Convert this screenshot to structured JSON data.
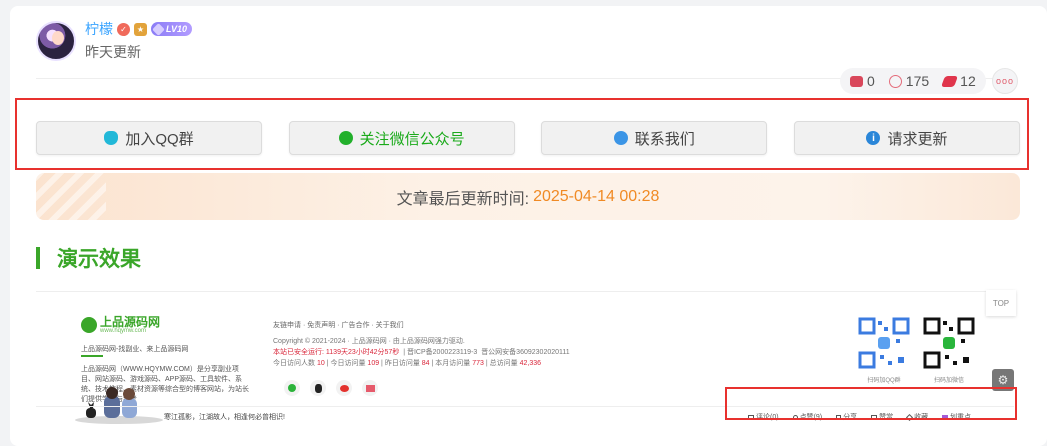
{
  "author": {
    "name": "柠檬",
    "level": "LV10",
    "updated": "昨天更新"
  },
  "stats": {
    "comments": "0",
    "likes": "175",
    "shares": "12"
  },
  "buttons": {
    "qq": "加入QQ群",
    "wechat": "关注微信公众号",
    "contact": "联系我们",
    "request": "请求更新"
  },
  "notice": {
    "label": "文章最后更新时间:",
    "time": "2025-04-14 00:28"
  },
  "section": {
    "title": "演示效果"
  },
  "demo": {
    "logo_name": "上品源码网",
    "logo_url": "www.hqymw.com",
    "tagline": "上品源码网-找副业、来上品源码网",
    "desc": "上品源码网（WWW.HQYMW.COM）是分享副业项目、网站源码、游戏源码、APP源码、工具软件、系统、技术教程、素材资源等综合型的博客网站，为站长们提供学习与参考",
    "links": "友链申请 · 免责声明 · 广告合作 · 关于我们",
    "copyright": "Copyright © 2021-2024 · 上品源码网 · 由上品源码网强力驱动.",
    "run_label": "本站已安全运行:",
    "run_time": "1139天23小时42分57秒",
    "icp": "晋ICP备2000223119-3",
    "police": "晋公网安备36092302020111",
    "today_label": "今日访问人数",
    "today": "10",
    "today_visits_label": "今日访问量",
    "today_visits": "109",
    "yesterday_label": "昨日访问量",
    "yesterday": "84",
    "month_label": "本月访问量",
    "month": "773",
    "total_label": "总访问量",
    "total": "42,336",
    "qr1": "扫码加QQ群",
    "qr2": "扫码加微信",
    "slogan": "寒江孤影，江湖故人，相逢何必曾相识!",
    "top": "TOP",
    "actions": [
      "评论(0)",
      "点赞(9)",
      "分享",
      "赞赏",
      "收藏",
      "划重点"
    ]
  }
}
